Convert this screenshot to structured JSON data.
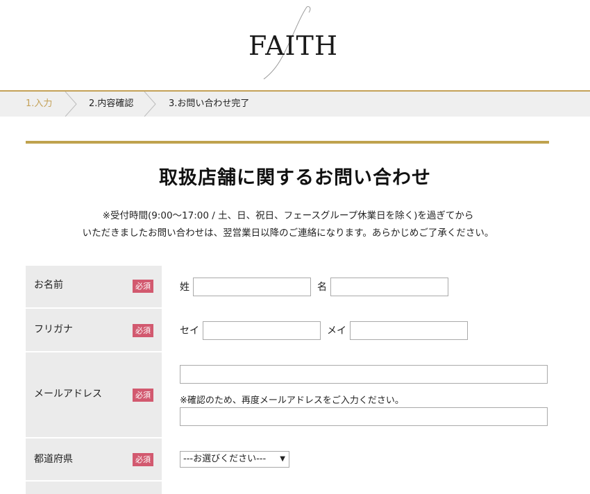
{
  "brand": {
    "logo_text": "FAITH"
  },
  "steps": [
    {
      "label": "1.入力",
      "active": true
    },
    {
      "label": "2.内容確認",
      "active": false
    },
    {
      "label": "3.お問い合わせ完了",
      "active": false
    }
  ],
  "page": {
    "title": "取扱店舗に関するお問い合わせ",
    "notice_line1": "※受付時間(9:00～17:00 / 土、日、祝日、フェースグループ休業日を除く)を過ぎてから",
    "notice_line2": "いただきましたお問い合わせは、翌営業日以降のご連絡になります。あらかじめご了承ください。"
  },
  "form": {
    "required_badge": "必須",
    "name": {
      "label": "お名前",
      "last_label": "姓",
      "first_label": "名",
      "last_value": "",
      "first_value": ""
    },
    "furigana": {
      "label": "フリガナ",
      "last_label": "セイ",
      "first_label": "メイ",
      "last_value": "",
      "first_value": ""
    },
    "email": {
      "label": "メールアドレス",
      "value": "",
      "confirm_hint": "※確認のため、再度メールアドレスをご入力ください。",
      "confirm_value": ""
    },
    "prefecture": {
      "label": "都道府県",
      "selected": "---お選びください---"
    }
  },
  "colors": {
    "accent_gold": "#c4a157",
    "required_pink": "#d2596f",
    "label_bg": "#ebebeb"
  }
}
